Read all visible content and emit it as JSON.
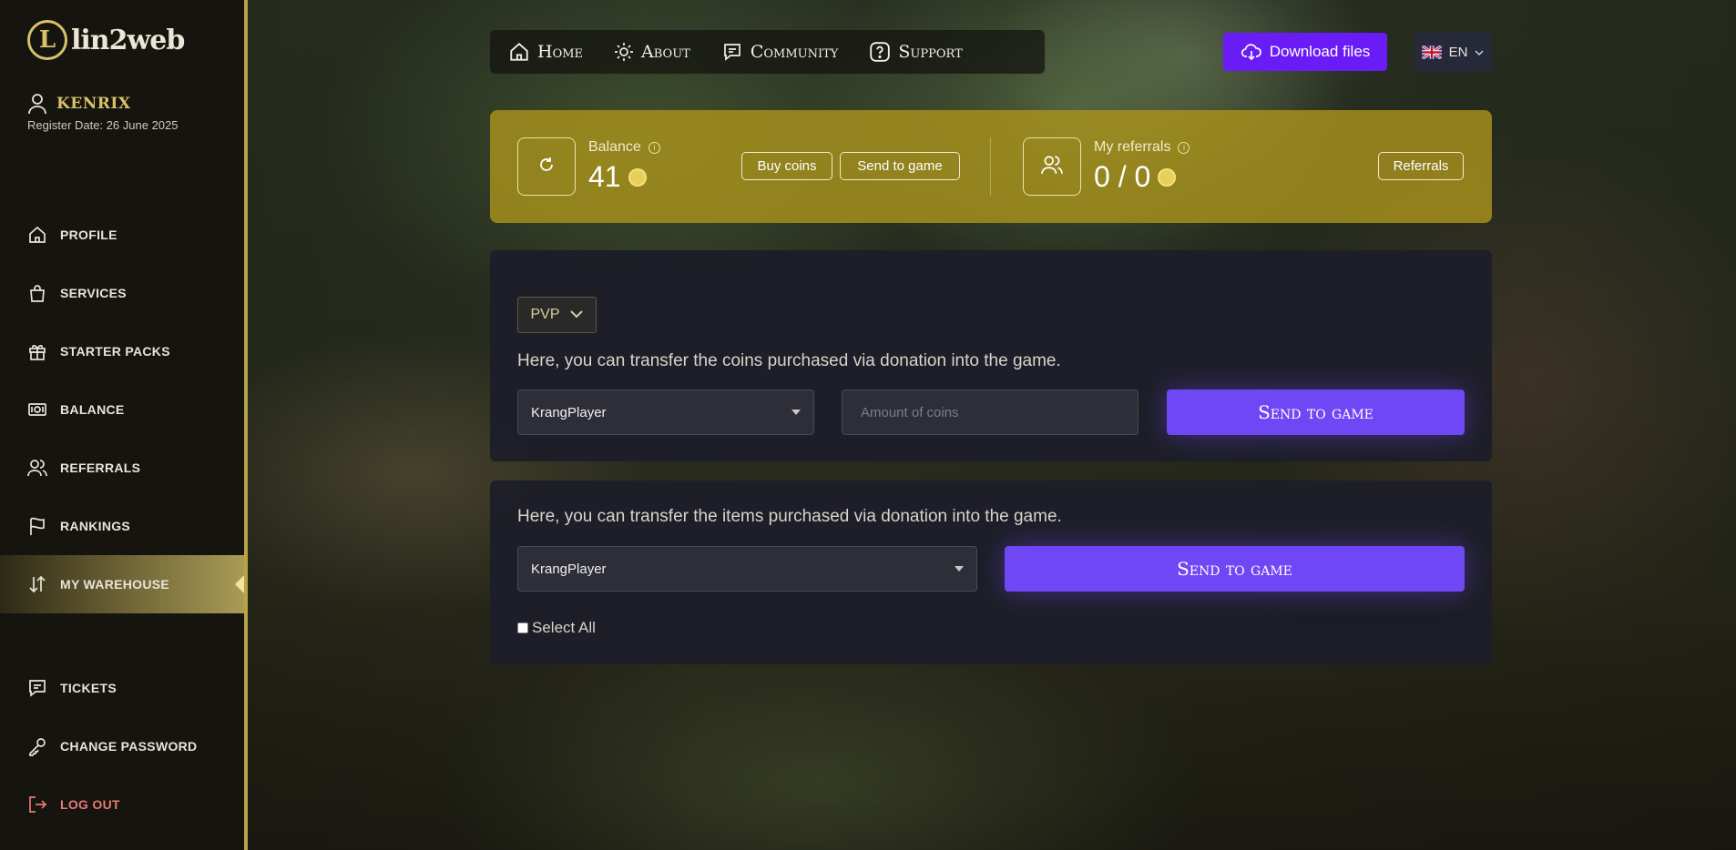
{
  "brand": {
    "name": "lin2web",
    "mark": "L"
  },
  "user": {
    "name": "KENRIX",
    "register_date": "Register Date: 26 June 2025"
  },
  "sidebar": {
    "items": [
      {
        "label": "PROFILE",
        "icon": "home-icon"
      },
      {
        "label": "SERVICES",
        "icon": "bag-icon"
      },
      {
        "label": "STARTER PACKS",
        "icon": "gift-icon"
      },
      {
        "label": "BALANCE",
        "icon": "cash-icon"
      },
      {
        "label": "REFERRALS",
        "icon": "users-icon"
      },
      {
        "label": "RANKINGS",
        "icon": "flag-icon"
      },
      {
        "label": "MY WAREHOUSE",
        "icon": "sort-arrows-icon",
        "active": true
      }
    ],
    "bottom_items": [
      {
        "label": "TICKETS",
        "icon": "chat-icon"
      },
      {
        "label": "CHANGE PASSWORD",
        "icon": "key-icon"
      },
      {
        "label": "LOG OUT",
        "icon": "logout-icon"
      }
    ]
  },
  "topnav": {
    "items": [
      {
        "label": "Home",
        "icon": "home-icon"
      },
      {
        "label": "About",
        "icon": "sun-icon"
      },
      {
        "label": "Community",
        "icon": "chat-icon"
      },
      {
        "label": "Support",
        "icon": "question-icon"
      }
    ],
    "download_label": "Download files",
    "language": "EN"
  },
  "balance": {
    "label": "Balance",
    "value": "41",
    "buy_label": "Buy coins",
    "send_label": "Send to game",
    "referrals_label": "My referrals",
    "referrals_value": "0 / 0",
    "referrals_button": "Referrals"
  },
  "coins_card": {
    "server": "PVP",
    "text": "Here, you can transfer the coins purchased via donation into the game.",
    "character": "KrangPlayer",
    "amount_placeholder": "Amount of coins",
    "send_label": "Send to game"
  },
  "items_card": {
    "text": "Here, you can transfer the items purchased via donation into the game.",
    "character": "KrangPlayer",
    "send_label": "Send to game",
    "select_all_label": "Select All"
  },
  "colors": {
    "accent": "#6a1cf6",
    "send_button": "#7047f5",
    "gold": "#a8921c",
    "sidebar_border": "#b8a24a",
    "logout": "#e77a72"
  }
}
